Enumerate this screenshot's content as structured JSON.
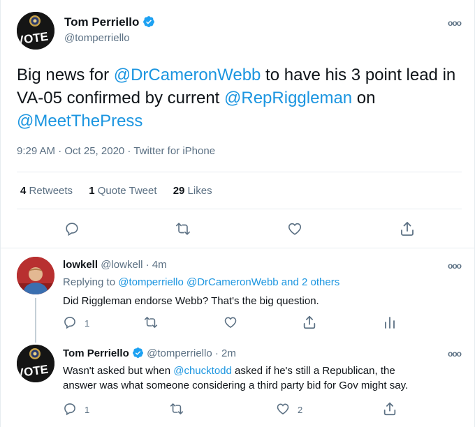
{
  "main_tweet": {
    "name": "Tom Perriello",
    "handle": "@tomperriello",
    "avatar_text": "VOTE",
    "text_parts": [
      "Big news for ",
      "@DrCameronWebb",
      " to have his 3 point lead in VA-05 confirmed by current ",
      "@RepRiggleman",
      " on ",
      "@MeetThePress"
    ],
    "timestamp": "9:29 AM · Oct 25, 2020 · Twitter for iPhone",
    "stats": {
      "retweets_count": "4",
      "retweets_label": "Retweets",
      "quotes_count": "1",
      "quotes_label": "Quote Tweet",
      "likes_count": "29",
      "likes_label": "Likes"
    }
  },
  "reply1": {
    "name": "lowkell",
    "handle": "@lowkell",
    "time": "· 4m",
    "replying_label": "Replying to",
    "replying_to": "@tomperriello @DrCameronWebb and 2 others",
    "text": "Did Riggleman endorse Webb? That's the big question.",
    "reply_count": "1"
  },
  "reply2": {
    "name": "Tom Perriello",
    "handle": "@tomperriello",
    "time": "· 2m",
    "avatar_text": "VOTE",
    "text_line1_pre": "Wasn't asked but when ",
    "text_line1_link": "@chucktodd",
    "text_line1_post": " asked if he's still a Republican, the",
    "text_line2": "answer was what someone considering a third party bid for Gov might say.",
    "reply_count": "1",
    "like_count": "2"
  },
  "colors": {
    "link": "#1b95e0",
    "secondary_text": "#5b7083",
    "verified": "#1da1f2",
    "divider": "#e6ecf0"
  }
}
